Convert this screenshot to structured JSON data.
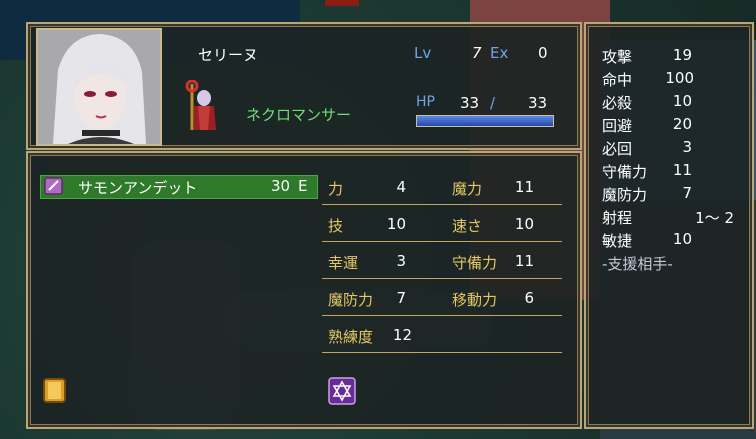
{
  "unit": {
    "name": "セリーヌ",
    "class": "ネクロマンサー",
    "lv_label": "Lv",
    "lv": "7",
    "ex_label": "Ex",
    "ex": "0",
    "hp_label": "HP",
    "hp_current": "33",
    "hp_sep": "/",
    "hp_max": "33",
    "hp_fraction": 1.0
  },
  "item": {
    "name": "サモンアンデット",
    "uses": "30",
    "rank": "E",
    "icon": "tome-icon"
  },
  "stats": [
    {
      "label": "力",
      "value": "4"
    },
    {
      "label": "魔力",
      "value": "11"
    },
    {
      "label": "技",
      "value": "10"
    },
    {
      "label": "速さ",
      "value": "10"
    },
    {
      "label": "幸運",
      "value": "3"
    },
    {
      "label": "守備力",
      "value": "11"
    },
    {
      "label": "魔防力",
      "value": "7"
    },
    {
      "label": "移動力",
      "value": "6"
    },
    {
      "label": "熟練度",
      "value": "12"
    }
  ],
  "combat": [
    {
      "label": "攻撃",
      "value": "19"
    },
    {
      "label": "命中",
      "value": "100"
    },
    {
      "label": "必殺",
      "value": "10"
    },
    {
      "label": "回避",
      "value": "20"
    },
    {
      "label": "必回",
      "value": "3"
    },
    {
      "label": "守備力",
      "value": "11"
    },
    {
      "label": "魔防力",
      "value": "7"
    },
    {
      "label": "射程",
      "value": "1〜 2"
    },
    {
      "label": "敏捷",
      "value": "10"
    }
  ],
  "support_label": "-支援相手-",
  "colors": {
    "stat_label": "#e3c863",
    "level_label": "#6fa4e8",
    "class_text": "#6ee078",
    "item_highlight": "#2e7a2a",
    "frame": "#b8a57a"
  }
}
